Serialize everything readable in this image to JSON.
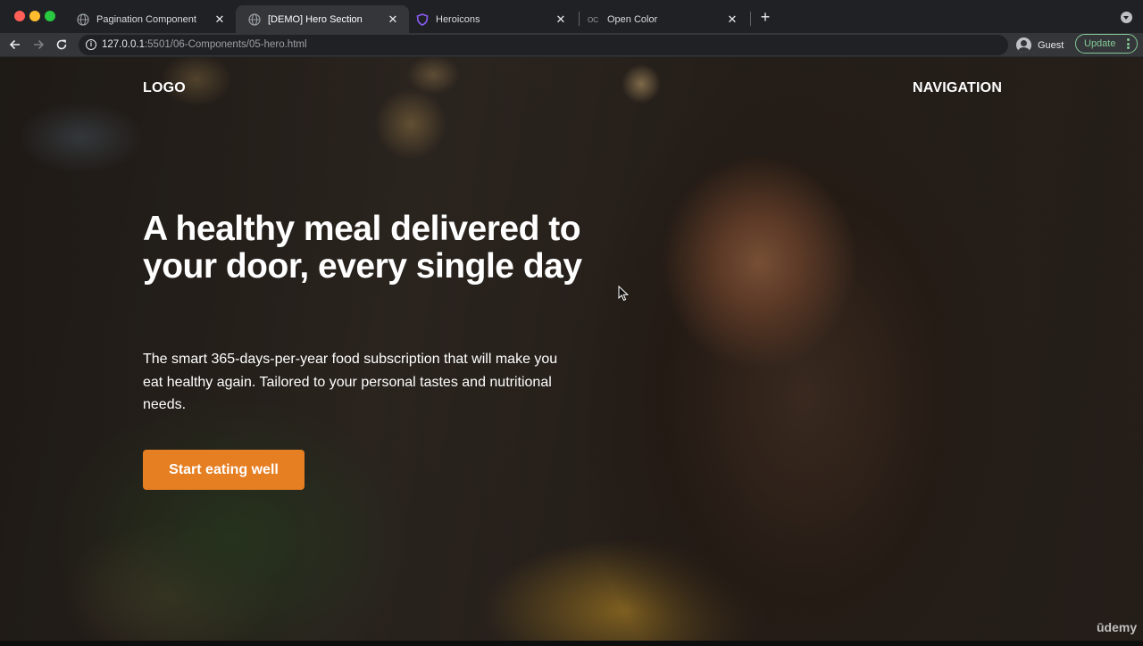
{
  "browser": {
    "tabs": [
      {
        "title": "Pagination Component",
        "favicon": "globe-icon"
      },
      {
        "title": "[DEMO] Hero Section",
        "favicon": "globe-icon",
        "active": true
      },
      {
        "title": "Heroicons",
        "favicon": "shield-icon"
      },
      {
        "title": "Open Color",
        "favicon": "oc-icon"
      }
    ],
    "close_glyph": "✕",
    "new_tab_glyph": "+",
    "url_host": "127.0.0.1",
    "url_rest": ":5501/06-Components/05-hero.html",
    "profile_label": "Guest",
    "update_label": "Update",
    "colors": {
      "update_accent": "#81c995"
    }
  },
  "page": {
    "logo": "LOGO",
    "navigation": "NAVIGATION",
    "hero": {
      "title": "A healthy meal delivered to your door, every single day",
      "description": "The smart 365-days-per-year food subscription that will make you eat healthy again. Tailored to your personal tastes and nutritional needs.",
      "cta_label": "Start eating well"
    },
    "colors": {
      "cta_background": "#e67e22",
      "text": "#ffffff"
    }
  },
  "watermark": "ūdemy"
}
